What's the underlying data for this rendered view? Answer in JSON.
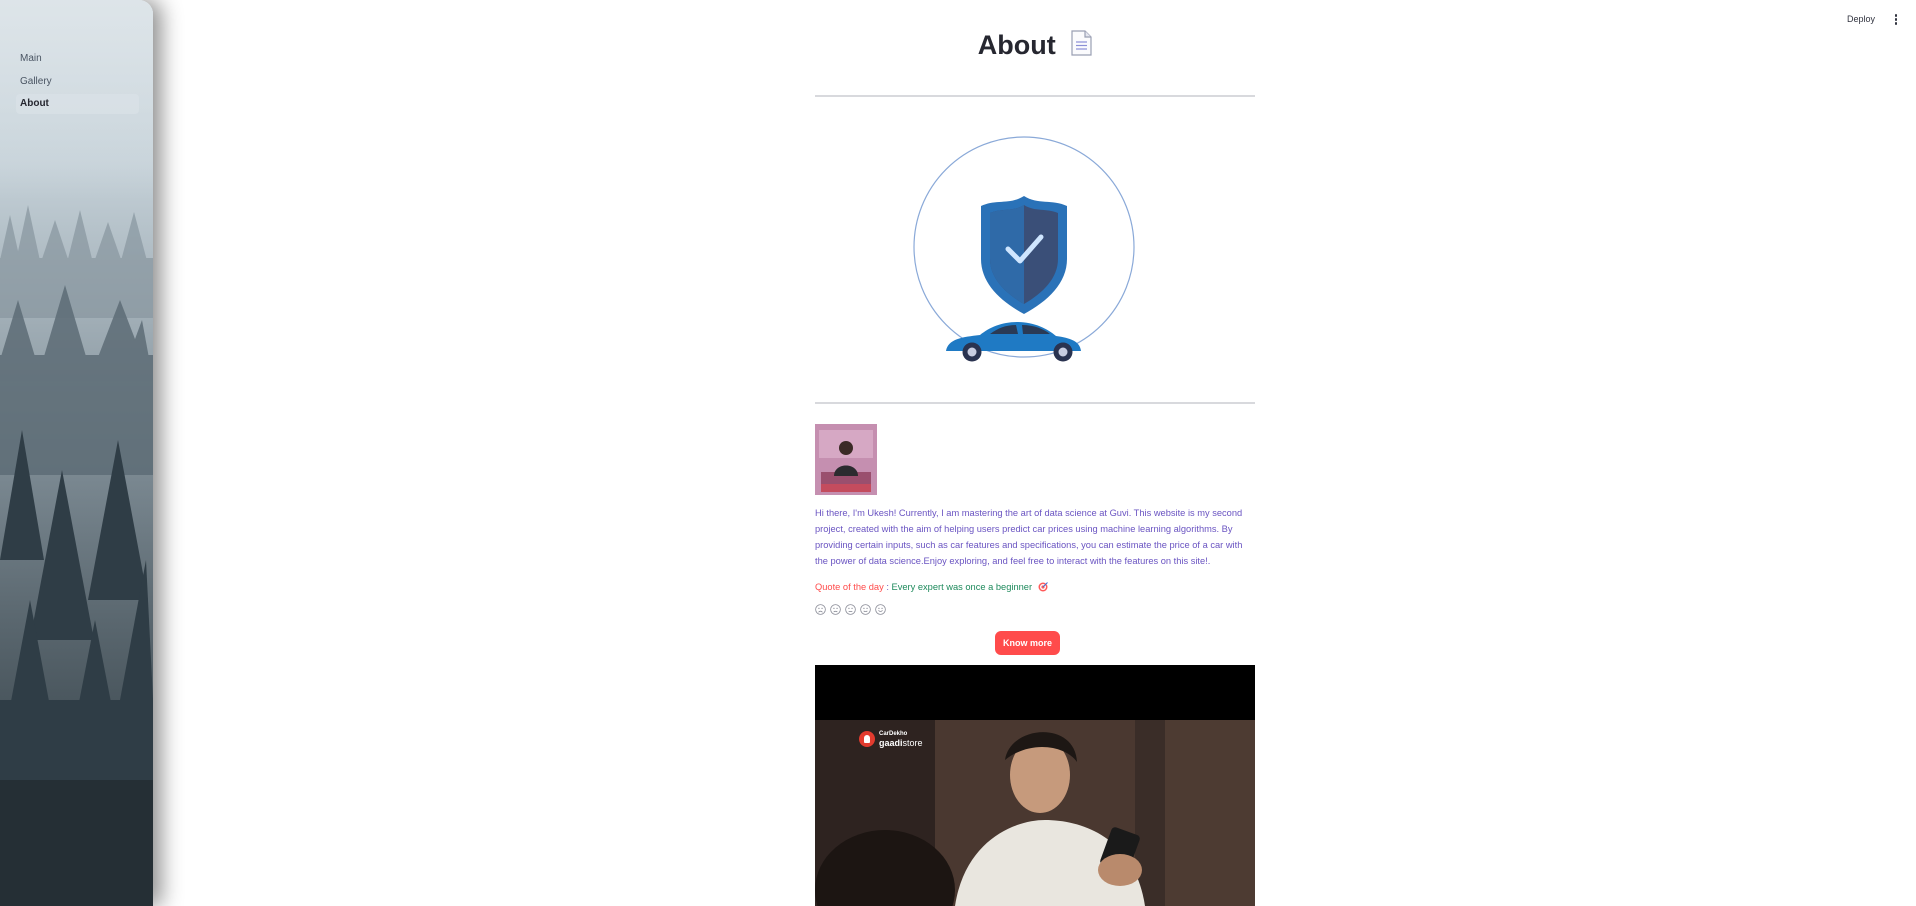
{
  "sidebar": {
    "items": [
      {
        "label": "Main",
        "active": false
      },
      {
        "label": "Gallery",
        "active": false
      },
      {
        "label": "About",
        "active": true
      }
    ]
  },
  "header": {
    "deploy_label": "Deploy",
    "menu_icon": "vertical-ellipsis-icon"
  },
  "page": {
    "title": "About",
    "title_icon": "document-icon",
    "hero_image": "shield-check-car-illustration",
    "bio": "Hi there, I'm Ukesh! Currently, I am mastering the art of data science at Guvi. This website is my second project, created with the aim of helping users predict car prices using machine learning algorithms. By providing certain inputs, such as car features and specifications, you can estimate the price of a car with the power of data science.Enjoy exploring, and feel free to interact with the features on this site!.",
    "quote_label": "Quote of the day",
    "quote_sep": " : ",
    "quote_text": "Every expert was once a beginner",
    "quote_icon": "target-icon",
    "rating_faces": [
      "very-sad-face-icon",
      "sad-face-icon",
      "neutral-face-icon",
      "smile-face-icon",
      "very-happy-face-icon"
    ],
    "button_label": "Know more",
    "video": {
      "brand_top": "CarDekho",
      "brand_main": "gaadi",
      "brand_sub": "store"
    }
  },
  "colors": {
    "accent": "#ff4b4b",
    "bio_text": "#6a54c2",
    "quote_text": "#1e8a5c",
    "shield": "#2a72b8",
    "car": "#1f7ac4"
  }
}
